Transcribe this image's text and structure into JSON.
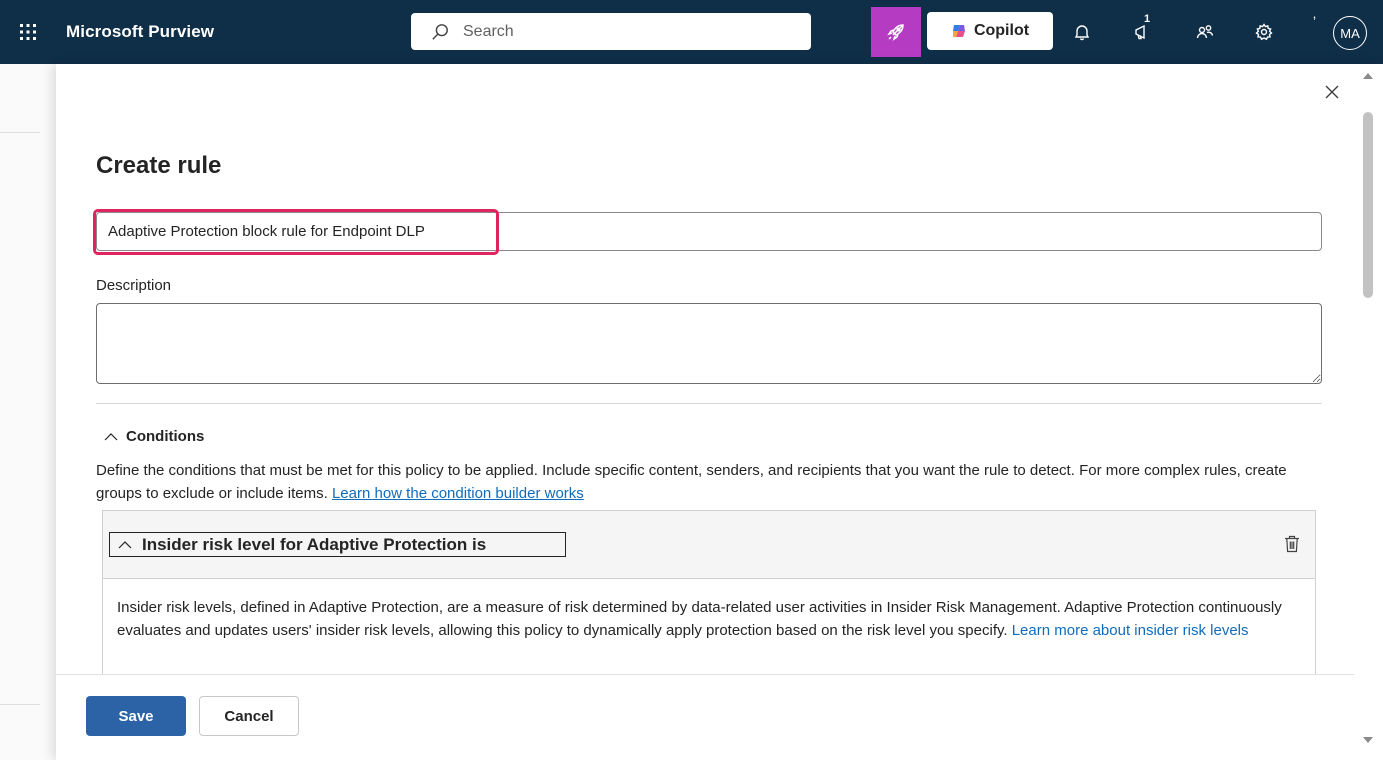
{
  "topbar": {
    "app_title": "Microsoft Purview",
    "search_placeholder": "Search",
    "copilot_label": "Copilot",
    "notification_count": "1",
    "tick": "ʼ",
    "avatar_initials": "MA"
  },
  "panel": {
    "title": "Create rule",
    "rule_name_value": "Adaptive Protection block rule for Endpoint DLP",
    "description_label": "Description",
    "description_value": "",
    "conditions": {
      "header": "Conditions",
      "description_text": "Define the conditions that must be met for this policy to be applied. Include specific content, senders, and recipients that you want the rule to detect. For more complex rules, create groups to exclude or include items. ",
      "learn_link": "Learn how the condition builder works",
      "card": {
        "title": "Insider risk level for Adaptive Protection is",
        "body_text": "Insider risk levels, defined in Adaptive Protection, are a measure of risk determined by data-related user activities in Insider Risk Management. Adaptive Protection continuously evaluates and updates users' insider risk levels, allowing this policy to dynamically apply protection based on the risk level you specify. ",
        "body_link": "Learn more about insider risk levels"
      }
    }
  },
  "footer": {
    "save_label": "Save",
    "cancel_label": "Cancel"
  },
  "colors": {
    "topbar_bg": "#0f2e48",
    "rocket_bg": "#b53bc3",
    "primary": "#2b63a6",
    "highlight": "#e0245e",
    "link": "#0f6cbd"
  },
  "icons": [
    "waffle-icon",
    "search-icon",
    "rocket-icon",
    "copilot-logo-icon",
    "bell-icon",
    "megaphone-icon",
    "people-icon",
    "gear-icon",
    "close-icon",
    "chevron-up-icon",
    "trash-icon"
  ]
}
